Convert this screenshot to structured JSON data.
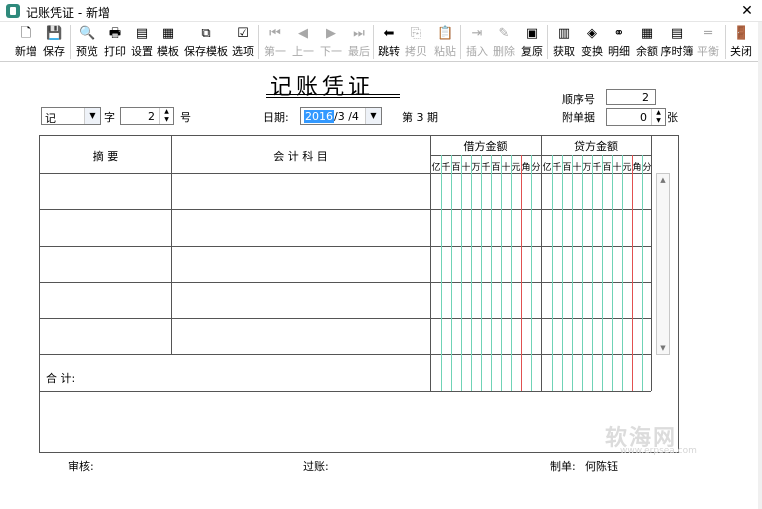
{
  "window": {
    "title": "记账凭证 - 新增",
    "close_label": "✕"
  },
  "toolbar": {
    "buttons": [
      {
        "label": "新增",
        "icon": "new-doc-icon",
        "glyph": "🗋",
        "enabled": true
      },
      {
        "label": "保存",
        "icon": "save-icon",
        "glyph": "💾",
        "enabled": true
      },
      {
        "label": "预览",
        "icon": "preview-icon",
        "glyph": "🔍",
        "enabled": true
      },
      {
        "label": "打印",
        "icon": "print-icon",
        "glyph": "🖶",
        "enabled": true
      },
      {
        "label": "设置",
        "icon": "settings-icon",
        "glyph": "▤",
        "enabled": true
      },
      {
        "label": "模板",
        "icon": "template-icon",
        "glyph": "▦",
        "enabled": true
      },
      {
        "label": "保存模板",
        "icon": "save-template-icon",
        "glyph": "⧉",
        "enabled": true
      },
      {
        "label": "选项",
        "icon": "options-icon",
        "glyph": "☑",
        "enabled": true
      },
      {
        "label": "第一",
        "icon": "first-icon",
        "glyph": "⏮",
        "enabled": false
      },
      {
        "label": "上一",
        "icon": "prev-icon",
        "glyph": "◀",
        "enabled": false
      },
      {
        "label": "下一",
        "icon": "next-icon",
        "glyph": "▶",
        "enabled": false
      },
      {
        "label": "最后",
        "icon": "last-icon",
        "glyph": "⏭",
        "enabled": false
      },
      {
        "label": "跳转",
        "icon": "jump-icon",
        "glyph": "⬅",
        "enabled": true
      },
      {
        "label": "拷贝",
        "icon": "copy-icon",
        "glyph": "⎘",
        "enabled": false
      },
      {
        "label": "粘贴",
        "icon": "paste-icon",
        "glyph": "📋",
        "enabled": false
      },
      {
        "label": "插入",
        "icon": "insert-icon",
        "glyph": "⇥",
        "enabled": false
      },
      {
        "label": "删除",
        "icon": "delete-icon",
        "glyph": "✎",
        "enabled": false
      },
      {
        "label": "复原",
        "icon": "restore-icon",
        "glyph": "▣",
        "enabled": true
      },
      {
        "label": "获取",
        "icon": "fetch-icon",
        "glyph": "▥",
        "enabled": true
      },
      {
        "label": "变换",
        "icon": "transform-icon",
        "glyph": "◈",
        "enabled": true
      },
      {
        "label": "明细",
        "icon": "binoculars-icon",
        "glyph": "⚭",
        "enabled": true
      },
      {
        "label": "余额",
        "icon": "balance-icon",
        "glyph": "▦",
        "enabled": true
      },
      {
        "label": "序时簿",
        "icon": "journal-icon",
        "glyph": "▤",
        "enabled": true
      },
      {
        "label": "平衡",
        "icon": "balance-eq-icon",
        "glyph": "═",
        "enabled": false
      },
      {
        "label": "关闭",
        "icon": "exit-door-icon",
        "glyph": "🚪",
        "enabled": true
      }
    ]
  },
  "voucher": {
    "title": "记账凭证",
    "type_value": "记",
    "type_suffix": "字",
    "number_value": "2",
    "number_suffix": "号",
    "date_label": "日期:",
    "date_year": "2016",
    "date_rest": "/3 /4",
    "period_text": "第 3 期",
    "seq_label": "顺序号",
    "seq_value": "2",
    "attach_label": "附单据",
    "attach_value": "0",
    "attach_suffix": "张"
  },
  "table": {
    "col_summary": "摘   要",
    "col_account": "会 计 科 目",
    "col_debit": "借方金额",
    "col_credit": "贷方金额",
    "digits": [
      "亿",
      "千",
      "百",
      "十",
      "万",
      "千",
      "百",
      "十",
      "元",
      "角",
      "分"
    ],
    "total_label": "合   计:"
  },
  "footer": {
    "review_label": "审核:",
    "posting_label": "过账:",
    "maker_label": "制单:",
    "maker_value": "何陈钰"
  },
  "watermark": {
    "text": "软海网",
    "url_text": "www.erpsea.com"
  }
}
